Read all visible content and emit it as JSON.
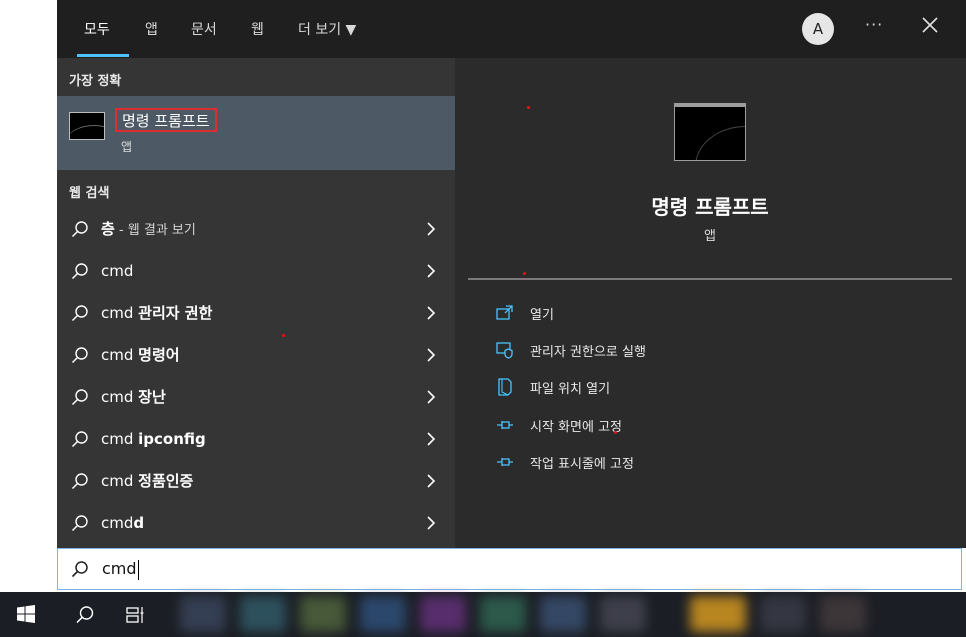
{
  "scope_tabs": [
    "모두",
    "앱",
    "문서",
    "웹",
    "더 보기 ▼"
  ],
  "header": {
    "avatar_letter": "A",
    "more": "···"
  },
  "left": {
    "best_match_heading": "가장 정확",
    "best_match": {
      "title": "명령 프롬프트",
      "subtitle": "앱"
    },
    "web_search_heading": "웹 검색",
    "web_rows": [
      {
        "prefix": "",
        "bold": "층",
        "suffix": " - 웹 결과 보기"
      },
      {
        "prefix": "cmd",
        "bold": "",
        "suffix": ""
      },
      {
        "prefix": "cmd ",
        "bold": "관리자 권한",
        "suffix": ""
      },
      {
        "prefix": "cmd ",
        "bold": "명령어",
        "suffix": ""
      },
      {
        "prefix": "cmd ",
        "bold": "장난",
        "suffix": ""
      },
      {
        "prefix": "cmd ",
        "bold": "ipconfig",
        "suffix": ""
      },
      {
        "prefix": "cmd ",
        "bold": "정품인증",
        "suffix": ""
      },
      {
        "prefix": "cmd",
        "bold": "d",
        "suffix": ""
      }
    ]
  },
  "right": {
    "app_name": "명령 프롬프트",
    "app_kind": "앱",
    "actions": [
      {
        "label": "열기",
        "icon": "open-icon"
      },
      {
        "label": "관리자 권한으로 실행",
        "icon": "shield-admin-icon"
      },
      {
        "label": "파일 위치 열기",
        "icon": "file-location-icon"
      },
      {
        "label": "시작 화면에 고정",
        "icon": "pin-icon"
      },
      {
        "label": "작업 표시줄에 고정",
        "icon": "pin-icon"
      }
    ]
  },
  "search": {
    "query": "cmd"
  },
  "colors": {
    "accent": "#4cc2ff",
    "selected_row": "#4d5a66",
    "highlight_border": "#d9302f"
  }
}
